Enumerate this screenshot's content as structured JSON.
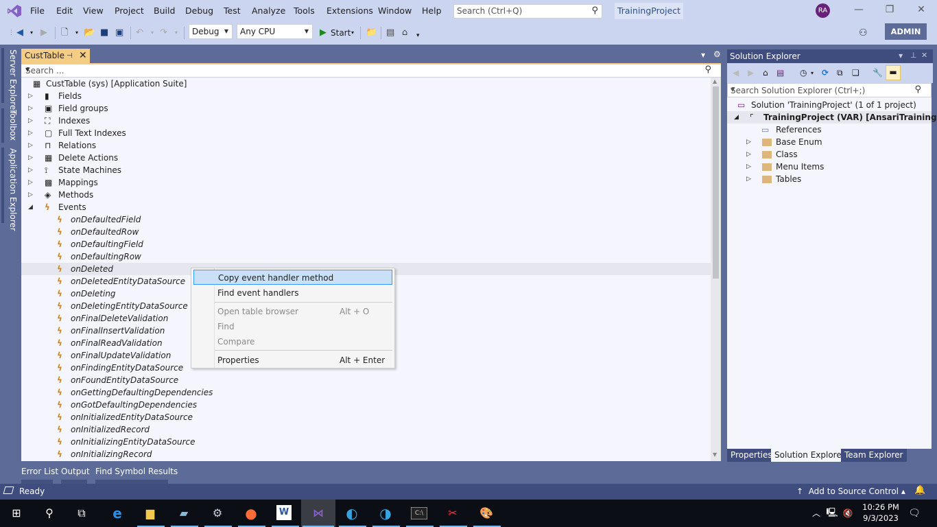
{
  "app": {
    "title": "TrainingProject",
    "user_initials": "RA",
    "menu": [
      "File",
      "Edit",
      "View",
      "Project",
      "Build",
      "Debug",
      "Test",
      "Analyze",
      "Tools",
      "Extensions",
      "Window",
      "Help"
    ],
    "quick_search_placeholder": "Search (Ctrl+Q)",
    "admin_label": "ADMIN"
  },
  "toolbar": {
    "config": "Debug",
    "platform": "Any CPU",
    "start_label": "Start"
  },
  "left_tabs": [
    "Server Explorer",
    "Toolbox",
    "Application Explorer"
  ],
  "document": {
    "tab_label": "CustTable",
    "search_placeholder": "Search ...",
    "root": "CustTable (sys) [Application Suite]",
    "nodes": [
      {
        "label": "Fields",
        "icon": "field-icon"
      },
      {
        "label": "Field groups",
        "icon": "field-group-icon"
      },
      {
        "label": "Indexes",
        "icon": "index-icon"
      },
      {
        "label": "Full Text Indexes",
        "icon": "fulltext-index-icon"
      },
      {
        "label": "Relations",
        "icon": "relation-icon"
      },
      {
        "label": "Delete Actions",
        "icon": "delete-action-icon"
      },
      {
        "label": "State Machines",
        "icon": "state-machine-icon"
      },
      {
        "label": "Mappings",
        "icon": "mapping-icon"
      },
      {
        "label": "Methods",
        "icon": "method-icon"
      },
      {
        "label": "Events",
        "icon": "event-icon"
      }
    ],
    "events": [
      "onDefaultedField",
      "onDefaultedRow",
      "onDefaultingField",
      "onDefaultingRow",
      "onDeleted",
      "onDeletedEntityDataSource",
      "onDeleting",
      "onDeletingEntityDataSource",
      "onFinalDeleteValidation",
      "onFinalInsertValidation",
      "onFinalReadValidation",
      "onFinalUpdateValidation",
      "onFindingEntityDataSource",
      "onFoundEntityDataSource",
      "onGettingDefaultingDependencies",
      "onGotDefaultingDependencies",
      "onInitializedEntityDataSource",
      "onInitializedRecord",
      "onInitializingEntityDataSource",
      "onInitializingRecord"
    ],
    "selected_event": "onDeleted"
  },
  "context_menu": {
    "items": [
      {
        "label": "Copy event handler method",
        "shortcut": "",
        "enabled": true,
        "highlighted": true
      },
      {
        "label": "Find event handlers",
        "shortcut": "",
        "enabled": true
      },
      {
        "label": "Open table browser",
        "shortcut": "Alt + O",
        "enabled": false
      },
      {
        "label": "Find",
        "shortcut": "",
        "enabled": false
      },
      {
        "label": "Compare",
        "shortcut": "",
        "enabled": false
      },
      {
        "label": "Properties",
        "shortcut": "Alt + Enter",
        "enabled": true
      }
    ]
  },
  "solution_explorer": {
    "title": "Solution Explorer",
    "search_placeholder": "Search Solution Explorer (Ctrl+;)",
    "solution": "Solution 'TrainingProject' (1 of 1 project)",
    "project": "TrainingProject (VAR) [AnsariTraining]",
    "references": "References",
    "folders": [
      "Base Enum",
      "Class",
      "Menu Items",
      "Tables"
    ],
    "tabs": [
      "Properties",
      "Solution Explorer",
      "Team Explorer"
    ],
    "active_tab": "Solution Explorer"
  },
  "bottom_tabs": [
    "Error List",
    "Output",
    "Find Symbol Results"
  ],
  "status": {
    "text": "Ready",
    "source_control": "Add to Source Control"
  },
  "taskbar": {
    "time": "10:26 PM",
    "date": "9/3/2023",
    "apps": [
      "start",
      "search",
      "task-view",
      "internet-explorer",
      "file-explorer",
      "notepad",
      "settings",
      "postman",
      "word",
      "visual-studio",
      "edge",
      "edge-beta",
      "command-prompt",
      "snipping-tool",
      "paint"
    ]
  },
  "colors": {
    "accent": "#68217a",
    "chrome": "#ccd5f0",
    "panel_frame": "#5d6b99",
    "tab_active": "#f5cc84",
    "status_bar": "#3f4c7e",
    "event_icon": "#d18616"
  }
}
